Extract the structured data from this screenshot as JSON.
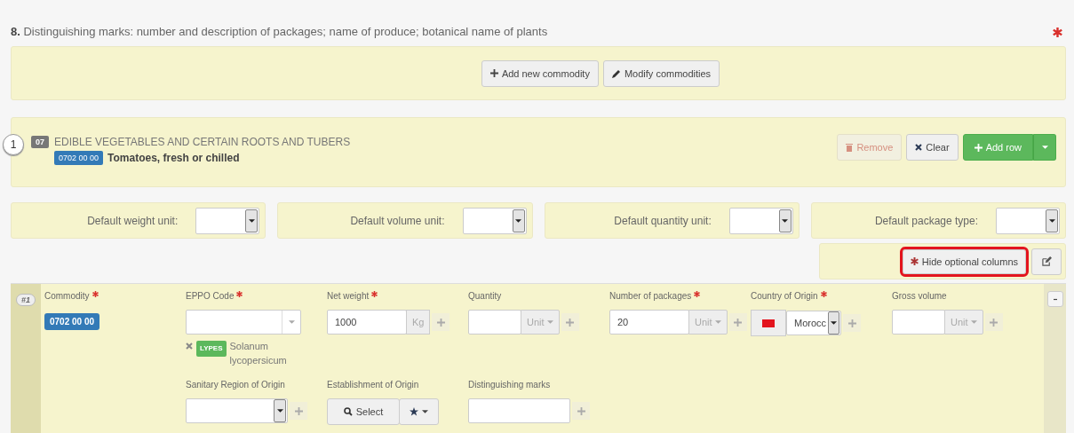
{
  "section": {
    "number": "8.",
    "title": "Distinguishing marks: number and description of packages; name of produce; botanical name of plants",
    "required": true
  },
  "toolbar_buttons": [
    {
      "label": "Add new commodity"
    },
    {
      "label": "Modify commodities"
    }
  ],
  "commodity": {
    "index": "1",
    "chapter_code": "07",
    "chapter_title": "EDIBLE VEGETABLES AND CERTAIN ROOTS AND TUBERS",
    "code": "0702 00 00",
    "name": "Tomatoes, fresh or chilled"
  },
  "actions": [
    {
      "label": "Remove",
      "kind": "remove",
      "disabled": true
    },
    {
      "label": "Clear",
      "kind": "clear",
      "disabled": false
    },
    {
      "label": "Add row",
      "kind": "add",
      "disabled": false
    }
  ],
  "defaults": [
    {
      "label": "Default weight unit:"
    },
    {
      "label": "Default volume unit:"
    },
    {
      "label": "Default quantity unit:"
    },
    {
      "label": "Default package type:"
    }
  ],
  "optional_columns_button": {
    "label": "Hide optional columns",
    "highlighted": true
  },
  "row": {
    "number": "#1",
    "lines": [
      [
        {
          "kind": "badge",
          "label": "Commodity",
          "required": true,
          "value": "0702 00 00"
        },
        {
          "kind": "eppo",
          "label": "EPPO Code",
          "required": true,
          "tag": "LYPES",
          "name": "Solanum lycopersicum"
        },
        {
          "kind": "addon",
          "label": "Net weight",
          "required": true,
          "value": "1000",
          "unit": "Kg"
        },
        {
          "kind": "unit",
          "label": "Quantity",
          "required": false,
          "unit": "Unit"
        },
        {
          "kind": "unit",
          "label": "Number of packages",
          "required": true,
          "value": "20",
          "unit": "Unit"
        },
        {
          "kind": "country",
          "label": "Country of Origin",
          "required": true,
          "value": "Morocc"
        },
        {
          "kind": "unit",
          "label": "Gross volume",
          "required": false,
          "unit": "Unit"
        }
      ],
      [
        {
          "kind": "select",
          "label": "Sanitary Region of Origin",
          "required": false
        },
        {
          "kind": "establishment",
          "label": "Establishment of Origin",
          "required": false,
          "button": "Select"
        },
        {
          "kind": "text",
          "label": "Distinguishing marks",
          "required": false
        }
      ]
    ]
  }
}
